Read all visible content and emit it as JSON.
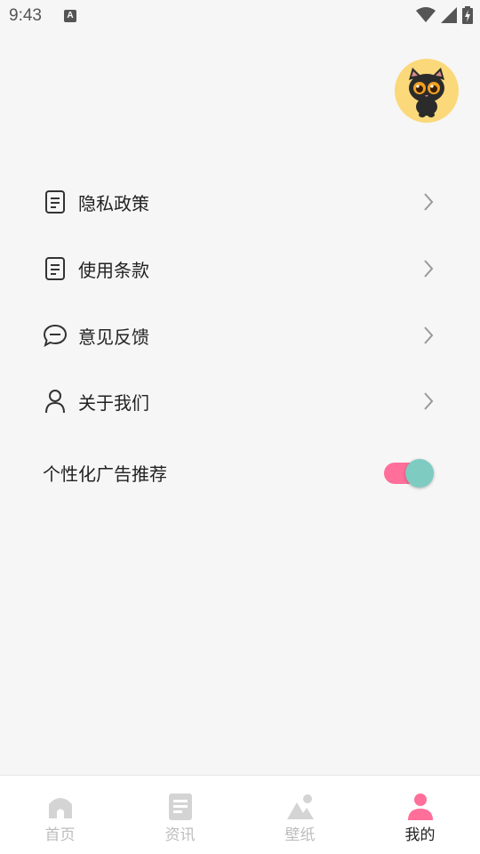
{
  "status_bar": {
    "time": "9:43",
    "notification_letter": "A"
  },
  "menu": [
    {
      "label": "隐私政策",
      "icon": "document-icon"
    },
    {
      "label": "使用条款",
      "icon": "document-icon"
    },
    {
      "label": "意见反馈",
      "icon": "chat-bubble-icon"
    },
    {
      "label": "关于我们",
      "icon": "person-icon"
    }
  ],
  "ad_toggle": {
    "label": "个性化广告推荐",
    "enabled": true
  },
  "bottom_nav": [
    {
      "label": "首页",
      "icon": "home-icon",
      "active": false
    },
    {
      "label": "资讯",
      "icon": "news-icon",
      "active": false
    },
    {
      "label": "壁纸",
      "icon": "wallpaper-icon",
      "active": false
    },
    {
      "label": "我的",
      "icon": "profile-icon",
      "active": true
    }
  ],
  "colors": {
    "toggle_track": "#ff6f9a",
    "toggle_knob": "#7ecbc2",
    "nav_active_icon": "#ff6f9a",
    "nav_inactive": "#d4d4d4",
    "avatar_bg": "#fbd97a"
  }
}
